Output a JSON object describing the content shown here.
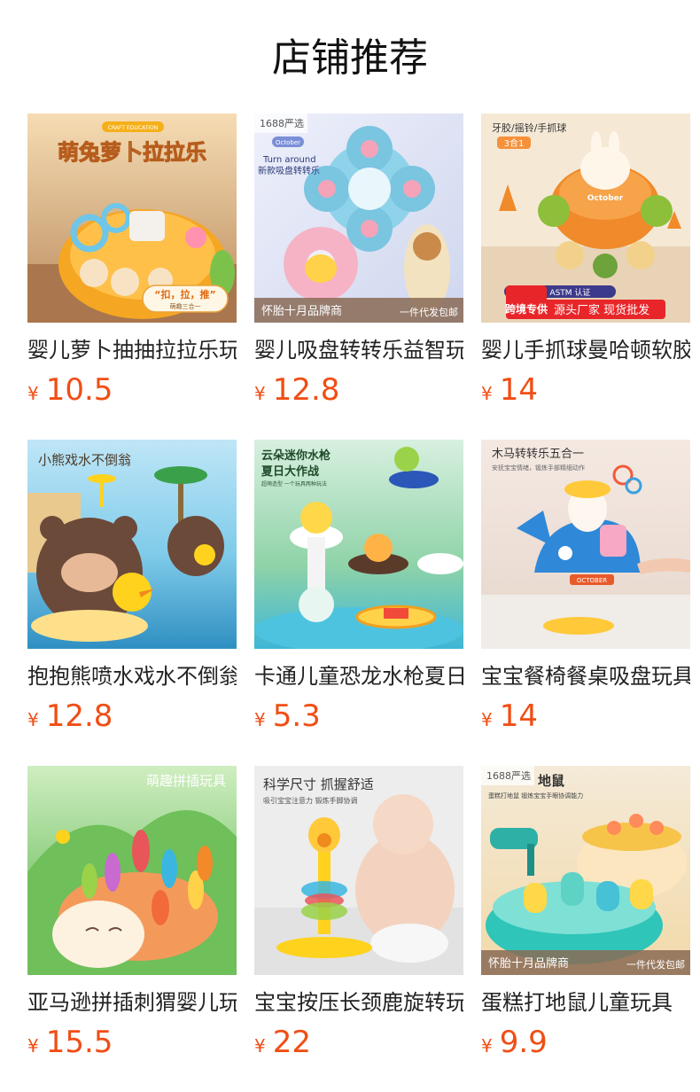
{
  "header": {
    "title": "店铺推荐"
  },
  "currency_symbol": "¥",
  "products": [
    {
      "name": "婴儿萝卜抽抽拉拉乐玩具",
      "price": "10.5",
      "image": {
        "headline": "萌兔萝卜拉拉乐",
        "tag": "CRAFT EDUCATION",
        "bubble": "“扣，拉，推”",
        "bubble_sub": "萌趣三合一",
        "bg": "#e9c79a",
        "accent": "#f08a1c"
      }
    },
    {
      "name": "婴儿吸盘转转乐益智玩具",
      "price": "12.8",
      "image": {
        "corner": "1688严选",
        "brand": "October",
        "headline": "Turn around",
        "sub": "新款吸盘转转乐",
        "footer_left": "怀胎十月品牌商",
        "footer_right": "一件代发包邮",
        "bg": "#dfe3f2",
        "accent": "#7ac5e0"
      }
    },
    {
      "name": "婴儿手抓球曼哈顿软胶玩具",
      "price": "14",
      "image": {
        "headline": "牙胶/摇铃/手抓球",
        "tag": "3合1",
        "brand": "October",
        "badge": "跨境专供",
        "cert": "CPC ASTM 认证",
        "slogan": "源头厂家  现货批发",
        "bg": "#f3e6d2",
        "accent": "#f08a2a"
      }
    },
    {
      "name": "抱抱熊喷水戏水不倒翁玩具",
      "price": "12.8",
      "image": {
        "headline": "小熊戏水不倒翁",
        "bg": "#9dd6ef",
        "accent": "#6b4a3a"
      }
    },
    {
      "name": "卡通儿童恐龙水枪夏日玩具",
      "price": "5.3",
      "image": {
        "headline": "云朵迷你水枪",
        "sub": "夏日大作战",
        "small": "超萌造型 一个玩具两种玩法",
        "bg": "#bde3c8",
        "accent": "#3aa54a"
      }
    },
    {
      "name": "宝宝餐椅餐桌吸盘玩具",
      "price": "14",
      "image": {
        "headline": "木马转转乐五合一",
        "sub": "安抚宝宝情绪，锻炼手部精细动作",
        "brand": "OCTOBER",
        "bg": "#f2e6de",
        "accent": "#2f88d8"
      }
    },
    {
      "name": "亚马逊拼插刺猬婴儿玩具",
      "price": "15.5",
      "image": {
        "headline": "萌趣拼插玩具",
        "bg": "#8fcf82",
        "accent": "#f07a3c"
      }
    },
    {
      "name": "宝宝按压长颈鹿旋转玩具",
      "price": "22",
      "image": {
        "headline": "科学尺寸 抓握舒适",
        "sub": "吸引宝宝注意力 锻炼手脚协调",
        "bg": "#eeeeee",
        "accent": "#f5c518"
      }
    },
    {
      "name": "蛋糕打地鼠儿童玩具",
      "price": "9.9",
      "image": {
        "corner": "1688严选",
        "headline": "地鼠",
        "sub": "蛋糕打地鼠 锻炼宝宝手眼协调能力",
        "footer_left": "怀胎十月品牌商",
        "footer_right": "一件代发包邮",
        "bg": "#dff0ee",
        "accent": "#2fc5b8"
      }
    }
  ]
}
